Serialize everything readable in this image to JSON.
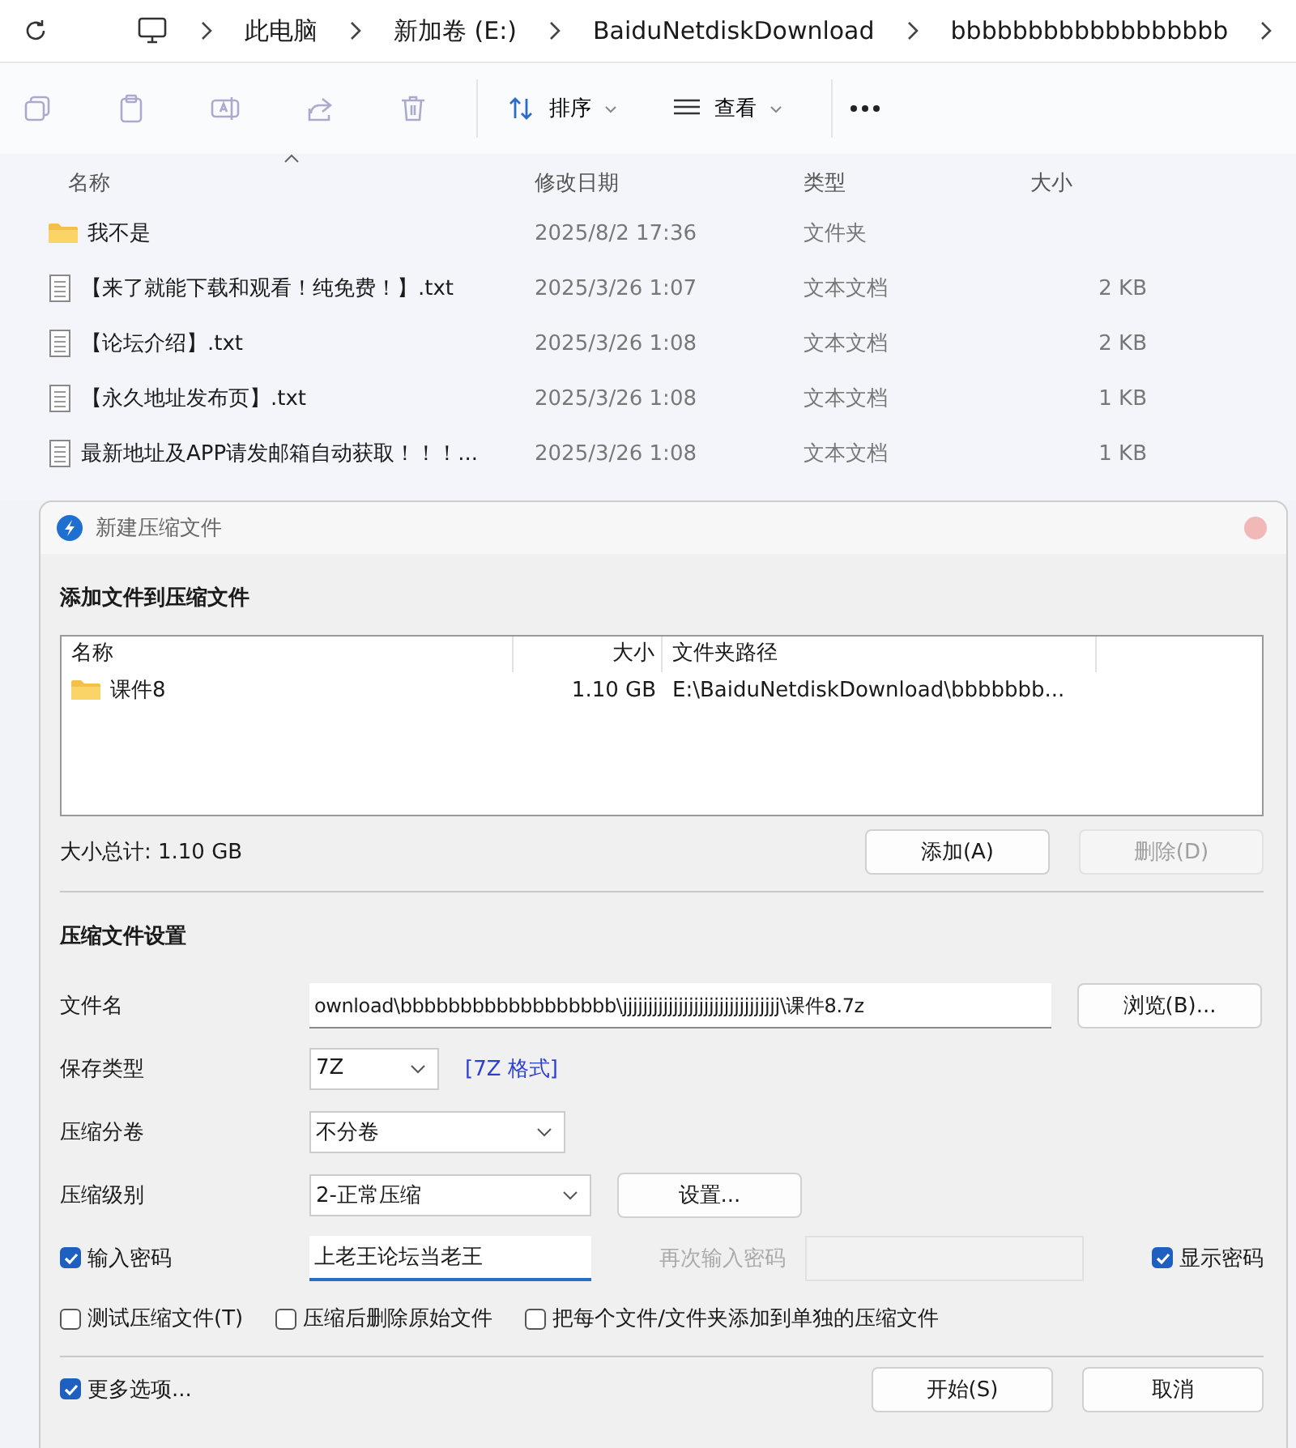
{
  "breadcrumb": [
    "此电脑",
    "新加卷 (E:)",
    "BaiduNetdiskDownload",
    "bbbbbbbbbbbbbbbbbb"
  ],
  "toolbar": {
    "sort_label": "排序",
    "view_label": "查看"
  },
  "file_list": {
    "columns": [
      "名称",
      "修改日期",
      "类型",
      "大小"
    ],
    "rows": [
      {
        "kind": "folder",
        "name": "我不是",
        "date": "2025/8/2 17:36",
        "type": "文件夹"
      },
      {
        "kind": "file",
        "name": "【来了就能下载和观看！纯免费！】.txt",
        "date": "2025/3/26 1:07",
        "type": "文本文档",
        "size": "2 KB"
      },
      {
        "kind": "file",
        "name": "【论坛介绍】.txt",
        "date": "2025/3/26 1:08",
        "type": "文本文档",
        "size": "2 KB"
      },
      {
        "kind": "file",
        "name": "【永久地址发布页】.txt",
        "date": "2025/3/26 1:08",
        "type": "文本文档",
        "size": "1 KB"
      },
      {
        "kind": "file",
        "name": "最新地址及APP请发邮箱自动获取！！！...",
        "date": "2025/3/26 1:08",
        "type": "文本文档",
        "size": "1 KB"
      }
    ]
  },
  "dialog": {
    "title": "新建压缩文件",
    "add_section_title": "添加文件到压缩文件",
    "file_table": {
      "columns": [
        "名称",
        "大小",
        "文件夹路径"
      ],
      "rows": [
        {
          "kind": "folder",
          "name": "课件8",
          "size": "1.10 GB",
          "path": "E:\\BaiduNetdiskDownload\\bbbbbbb..."
        }
      ]
    },
    "total_size": "大小总计: 1.10 GB",
    "add_button": {
      "label": "添加(A)",
      "disabled": false
    },
    "delete_button": {
      "label": "删除(D)",
      "disabled": true
    },
    "settings_title": "压缩文件设置",
    "filename": {
      "label": "文件名",
      "value": "ownload\\bbbbbbbbbbbbbbbbbb\\jjjjjjjjjjjjjjjjjjjjjjjjjjjjjjj\\课件8.7z",
      "browse_button": "浏览(B)..."
    },
    "save_type": {
      "label": "保存类型",
      "value": "7Z",
      "link": "[7Z 格式]"
    },
    "split": {
      "label": "压缩分卷",
      "value": "不分卷"
    },
    "level": {
      "label": "压缩级别",
      "value": "2-正常压缩",
      "settings_button": "设置..."
    },
    "password": {
      "label": "输入密码",
      "checked": true,
      "value": "上老王论坛当老王"
    },
    "confirm_password": {
      "label": "再次输入密码",
      "disabled": true
    },
    "show_password": {
      "label": "显示密码",
      "checked": true
    },
    "options": [
      {
        "label": "测试压缩文件(T)",
        "checked": false
      },
      {
        "label": "压缩后删除原始文件",
        "checked": false
      },
      {
        "label": "把每个文件/文件夹添加到单独的压缩文件",
        "checked": false
      }
    ],
    "more_options": {
      "label": "更多选项...",
      "checked": true
    },
    "start_button": "开始(S)",
    "cancel_button": "取消"
  }
}
